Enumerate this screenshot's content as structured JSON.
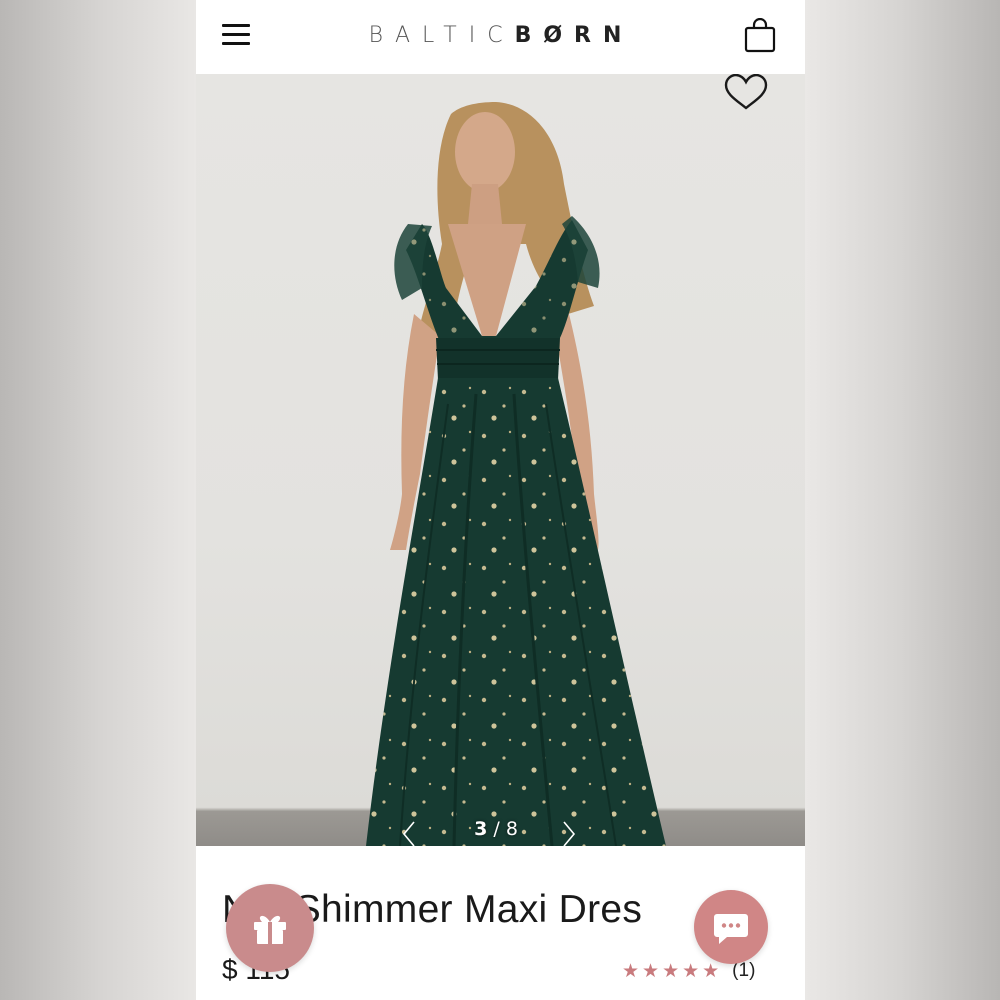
{
  "header": {
    "brand_part1": "BALTIC",
    "brand_part2": "BØRN",
    "menu_icon": "hamburger-menu-icon",
    "bag_icon": "shopping-bag-icon"
  },
  "gallery": {
    "current_index": "3",
    "separator": "/",
    "total": "8",
    "wishlist_icon": "heart-outline-icon",
    "prev_icon": "chevron-left-icon",
    "next_icon": "chevron-right-icon"
  },
  "product": {
    "title": "N   a Shimmer Maxi Dres",
    "price": "$ 115",
    "rating_value": 5,
    "rating_count": "(1)"
  },
  "widgets": {
    "gift_icon": "gift-icon",
    "chat_icon": "chat-bubble-icon"
  },
  "colors": {
    "accent_pink": "#c98b8c",
    "chat_pink": "#d08686",
    "star_color": "#c97b7e",
    "dress_green": "#163a31"
  }
}
